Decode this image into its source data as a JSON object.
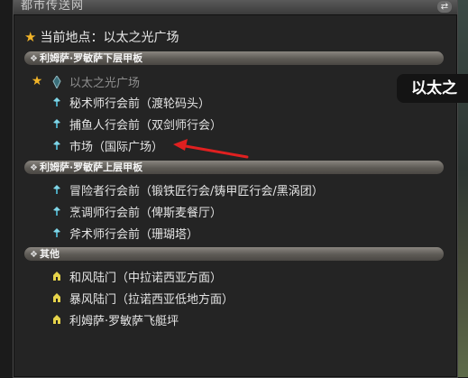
{
  "window": {
    "title": "都市传送网",
    "control_icon": "swap-arrows-icon"
  },
  "current": {
    "label": "当前地点：以太之光广场"
  },
  "sections": [
    {
      "label": "利姆萨·罗敏萨下层甲板",
      "items": [
        {
          "label": "以太之光广场",
          "current": true,
          "icon": "aetheryte-crystal-icon"
        },
        {
          "label": "秘术师行会前（渡轮码头）",
          "icon": "aethernet-shard-icon"
        },
        {
          "label": "捕鱼人行会前（双剑师行会）",
          "icon": "aethernet-shard-icon"
        },
        {
          "label": "市场（国际广场）",
          "icon": "aethernet-shard-icon"
        }
      ]
    },
    {
      "label": "利姆萨·罗敏萨上层甲板",
      "items": [
        {
          "label": "冒险者行会前（锻铁匠行会/铸甲匠行会/黑涡团）",
          "icon": "aethernet-shard-icon"
        },
        {
          "label": "烹调师行会前（俾斯麦餐厅）",
          "icon": "aethernet-shard-icon"
        },
        {
          "label": "斧术师行会前（珊瑚塔）",
          "icon": "aethernet-shard-icon"
        }
      ]
    },
    {
      "label": "其他",
      "items": [
        {
          "label": "和风陆门（中拉诺西亚方面）",
          "icon": "gate-icon"
        },
        {
          "label": "暴风陆门（拉诺西亚低地方面）",
          "icon": "gate-icon"
        },
        {
          "label": "利姆萨·罗敏萨飞艇坪",
          "icon": "gate-icon"
        }
      ]
    }
  ],
  "tooltip": {
    "text": "以太之"
  },
  "colors": {
    "star": "#f2b428",
    "shard": "#7fd6e8",
    "gate": "#e6d34a",
    "arrow": "#e02020"
  }
}
